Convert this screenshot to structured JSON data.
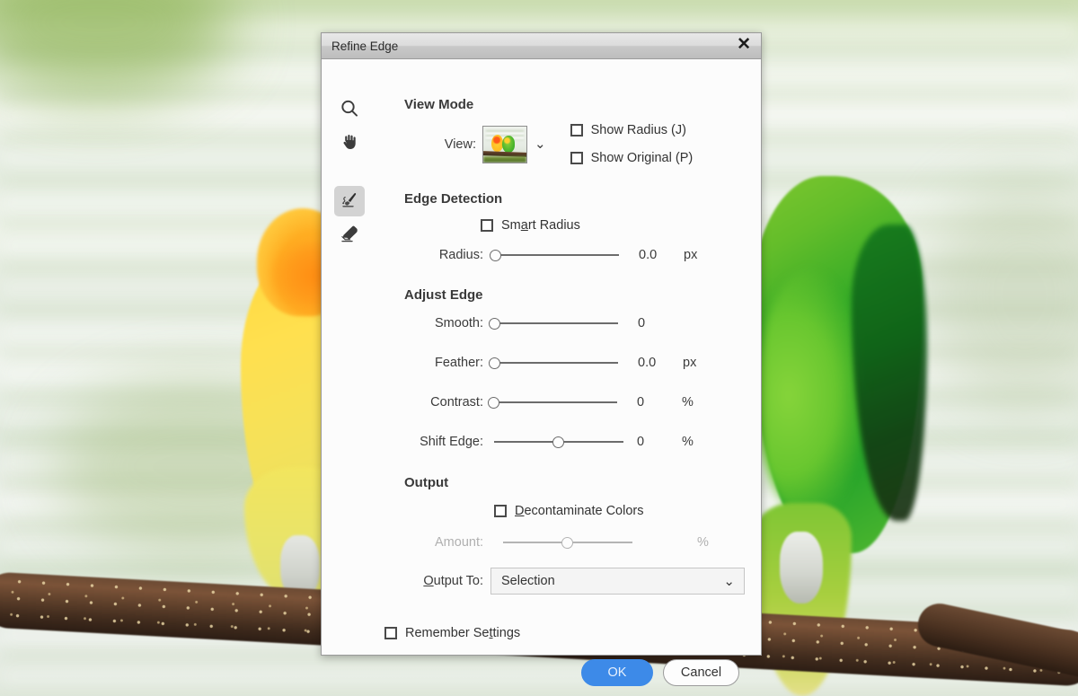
{
  "dialog": {
    "title": "Refine Edge",
    "close_icon": "close-icon"
  },
  "tools": [
    {
      "name": "zoom-tool",
      "icon": "magnifier-icon",
      "selected": false
    },
    {
      "name": "hand-tool",
      "icon": "hand-icon",
      "selected": false
    },
    {
      "name": "refine-radius-brush-tool",
      "icon": "brush-icon",
      "selected": true
    },
    {
      "name": "erase-refinements-tool",
      "icon": "eraser-icon",
      "selected": false
    }
  ],
  "view_mode": {
    "heading": "View Mode",
    "view_label": "View:",
    "thumbnail_alt": "two-parrots-preview",
    "dropdown_icon": "chevron-down-icon",
    "show_radius": {
      "label": "Show Radius (J)",
      "checked": false
    },
    "show_original": {
      "label": "Show Original (P)",
      "checked": false
    }
  },
  "edge_detection": {
    "heading": "Edge Detection",
    "smart_radius": {
      "label_pre": "Sm",
      "label_key": "a",
      "label_post": "rt Radius",
      "checked": false
    },
    "radius": {
      "label": "Radius:",
      "value": "0.0",
      "unit": "px",
      "position": 0
    }
  },
  "adjust_edge": {
    "heading": "Adjust Edge",
    "smooth": {
      "label": "Smooth:",
      "value": "0",
      "unit": "",
      "position": 0
    },
    "feather": {
      "label": "Feather:",
      "value": "0.0",
      "unit": "px",
      "position": 0
    },
    "contrast": {
      "label": "Contrast:",
      "value": "0",
      "unit": "%",
      "position": 0
    },
    "shift_edge": {
      "label": "Shift Edge:",
      "value": "0",
      "unit": "%",
      "position": 50
    }
  },
  "output": {
    "heading": "Output",
    "decontaminate": {
      "label_pre": "",
      "label_key": "D",
      "label_post": "econtaminate Colors",
      "checked": false
    },
    "amount": {
      "label": "Amount:",
      "value": "",
      "unit": "%",
      "position": 50,
      "disabled": true
    },
    "output_to": {
      "label_pre": "",
      "label_key": "O",
      "label_post": "utput To:",
      "value": "Selection",
      "dropdown_icon": "chevron-down-icon"
    }
  },
  "footer": {
    "remember": {
      "label_pre": "Remember Se",
      "label_key": "t",
      "label_post": "tings",
      "checked": false
    },
    "ok_label": "OK",
    "cancel_label": "Cancel"
  },
  "colors": {
    "accent_blue": "#3d8ae8",
    "titlebar_grey": "#d2d2d2",
    "dialog_bg": "#fcfcfc"
  }
}
